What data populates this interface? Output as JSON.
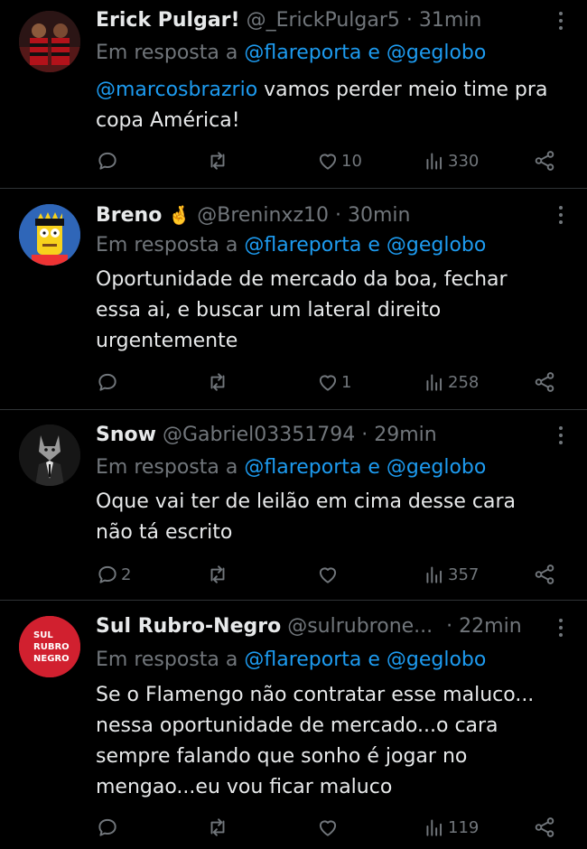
{
  "tweets": [
    {
      "name": "Erick Pulgar!",
      "handle": "@_ErickPulgar5",
      "separator": "·",
      "time": "31min",
      "reply_prefix": "Em resposta a",
      "reply_mentions": "@flareporta e @geglobo",
      "mention": "@marcosbrazrio",
      "text_lines": [
        "vamos perder meio time pra",
        "copa América!"
      ],
      "replies": "",
      "likes": "10",
      "views": "330"
    },
    {
      "name": "Breno",
      "emoji": "🤞",
      "handle": "@Breninxz10",
      "separator": "·",
      "time": "30min",
      "reply_prefix": "Em resposta a",
      "reply_mentions": "@flareporta e @geglobo",
      "text_lines": [
        "Oportunidade de mercado da boa, fechar",
        "essa ai, e buscar um lateral direito",
        "urgentemente"
      ],
      "replies": "",
      "likes": "1",
      "views": "258"
    },
    {
      "name": "Snow",
      "handle": "@Gabriel03351794",
      "separator": "·",
      "time": "29min",
      "reply_prefix": "Em resposta a",
      "reply_mentions": "@flareporta e @geglobo",
      "text_lines": [
        "Oque vai ter de leilão em cima desse cara",
        "não tá escrito"
      ],
      "replies": "2",
      "likes": "",
      "views": "357"
    },
    {
      "name": "Sul Rubro-Negro",
      "handle": "@sulrubrone...",
      "separator": "·",
      "time": "22min",
      "reply_prefix": "Em resposta a",
      "reply_mentions": "@flareporta e @geglobo",
      "text_lines": [
        "Se o Flamengo não contratar esse maluco...",
        "nessa oportunidade de mercado...o cara",
        "sempre falando que sonho é jogar no",
        "mengao...eu vou ficar maluco"
      ],
      "replies": "",
      "likes": "",
      "views": "119",
      "avatar_logo": [
        "SUL",
        "RUBRO",
        "NEGRO"
      ]
    }
  ],
  "colors": {
    "background": "#000000",
    "text": "#e7e9ea",
    "muted": "#71767b",
    "link": "#1d9bf0",
    "divider": "#2f3336",
    "logo_red": "#d1202f"
  },
  "icons": [
    "reply-icon",
    "retweet-icon",
    "like-icon",
    "views-icon",
    "share-icon",
    "more-icon"
  ]
}
